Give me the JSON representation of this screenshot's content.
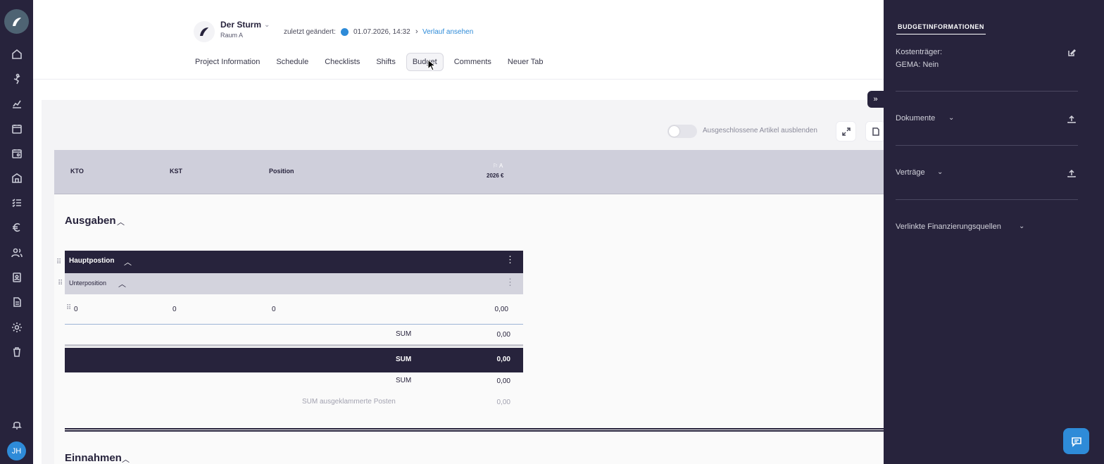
{
  "project": {
    "name": "Der Sturm",
    "room": "Raum A",
    "changed_label": "zuletzt geändert:",
    "changed_date": "01.07.2026, 14:32",
    "history_link": "Verlauf ansehen"
  },
  "tabs": [
    {
      "label": "Project Information"
    },
    {
      "label": "Schedule"
    },
    {
      "label": "Checklists"
    },
    {
      "label": "Shifts"
    },
    {
      "label": "Budget",
      "active": true
    },
    {
      "label": "Comments"
    },
    {
      "label": "Neuer Tab"
    }
  ],
  "toolbar": {
    "toggle_label": "Ausgeschlossene Artikel ausblenden",
    "toggle_on": false
  },
  "table": {
    "columns": {
      "kto": "KTO",
      "kst": "KST",
      "position": "Position",
      "flag": "A",
      "year": "2026 €"
    },
    "sections": {
      "expenses_title": "Ausgaben",
      "income_title": "Einnahmen"
    },
    "main_position": "Hauptpostion",
    "sub_position": "Unterposition",
    "item": {
      "kto": "0",
      "kst": "0",
      "position": "0",
      "value": "0,00"
    },
    "sums": [
      {
        "label": "SUM",
        "value": "0,00"
      },
      {
        "label": "SUM",
        "value": "0,00"
      },
      {
        "label": "SUM",
        "value": "0,00"
      },
      {
        "label": "SUM ausgeklammerte Posten",
        "value": "0,00"
      }
    ]
  },
  "sidebar": {
    "title": "BUDGETINFORMATIONEN",
    "cost_bearer": "Kostenträger:",
    "gema": "GEMA: Nein",
    "documents": "Dokumente",
    "contracts": "Verträge",
    "linked_funding": "Verlinkte Finanzierungsquellen"
  },
  "user": {
    "initials": "JH"
  },
  "colors": {
    "dark": "#27233c",
    "accent": "#2e8bd8"
  }
}
